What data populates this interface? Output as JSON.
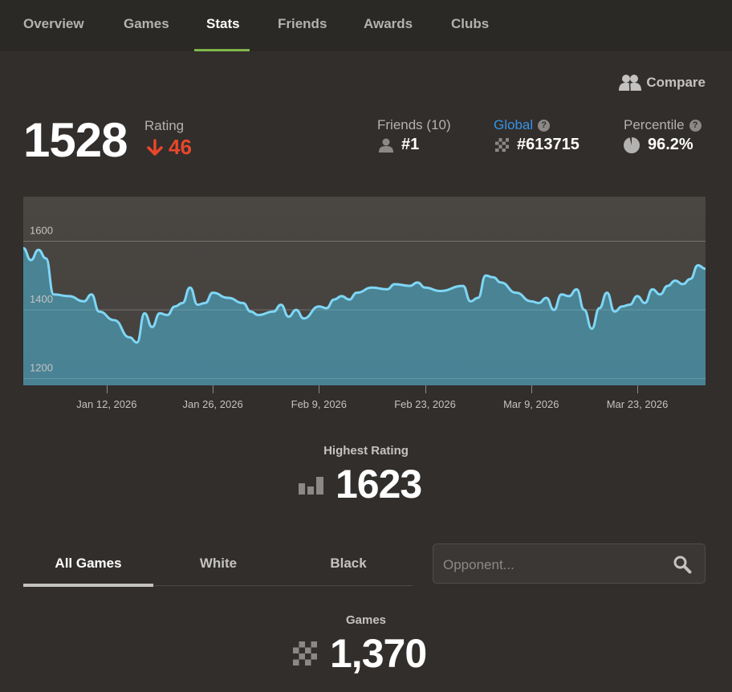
{
  "nav": {
    "tabs": [
      {
        "label": "Overview"
      },
      {
        "label": "Games"
      },
      {
        "label": "Stats",
        "active": true
      },
      {
        "label": "Friends"
      },
      {
        "label": "Awards"
      },
      {
        "label": "Clubs"
      }
    ]
  },
  "compare_label": "Compare",
  "rating": {
    "value": "1528",
    "label": "Rating",
    "change": "46",
    "change_direction": "down"
  },
  "stats": {
    "friends": {
      "label": "Friends (10)",
      "value": "#1",
      "icon": "person-icon"
    },
    "global": {
      "label": "Global",
      "value": "#613715",
      "icon": "chessboard-icon"
    },
    "percentile": {
      "label": "Percentile",
      "value": "96.2%",
      "icon": "pie-icon"
    }
  },
  "chart_data": {
    "type": "area",
    "ylim": [
      1180,
      1730
    ],
    "yticks": [
      1200,
      1400,
      1600
    ],
    "xticks": [
      {
        "label": "Jan 12, 2026",
        "day": 11
      },
      {
        "label": "Jan 26, 2026",
        "day": 25
      },
      {
        "label": "Feb 9, 2026",
        "day": 39
      },
      {
        "label": "Feb 23, 2026",
        "day": 53
      },
      {
        "label": "Mar 9, 2026",
        "day": 67
      },
      {
        "label": "Mar 23, 2026",
        "day": 81
      }
    ],
    "xrange": [
      0,
      90
    ],
    "series": [
      {
        "points": [
          [
            0,
            1580
          ],
          [
            1,
            1545
          ],
          [
            2,
            1575
          ],
          [
            3,
            1550
          ],
          [
            4,
            1445
          ],
          [
            6,
            1440
          ],
          [
            8,
            1425
          ],
          [
            9,
            1445
          ],
          [
            10,
            1395
          ],
          [
            12,
            1370
          ],
          [
            14,
            1320
          ],
          [
            15,
            1305
          ],
          [
            16,
            1390
          ],
          [
            17,
            1350
          ],
          [
            18,
            1390
          ],
          [
            19,
            1385
          ],
          [
            20,
            1410
          ],
          [
            21,
            1420
          ],
          [
            22,
            1465
          ],
          [
            23,
            1415
          ],
          [
            24,
            1420
          ],
          [
            25,
            1450
          ],
          [
            27,
            1435
          ],
          [
            29,
            1420
          ],
          [
            30,
            1395
          ],
          [
            31,
            1385
          ],
          [
            33,
            1395
          ],
          [
            34,
            1415
          ],
          [
            35,
            1380
          ],
          [
            36,
            1400
          ],
          [
            37,
            1375
          ],
          [
            39,
            1410
          ],
          [
            40,
            1405
          ],
          [
            41,
            1430
          ],
          [
            42,
            1440
          ],
          [
            43,
            1430
          ],
          [
            44,
            1450
          ],
          [
            46,
            1465
          ],
          [
            48,
            1460
          ],
          [
            49,
            1475
          ],
          [
            51,
            1470
          ],
          [
            52,
            1480
          ],
          [
            53,
            1465
          ],
          [
            55,
            1455
          ],
          [
            58,
            1470
          ],
          [
            59,
            1425
          ],
          [
            60,
            1435
          ],
          [
            61,
            1500
          ],
          [
            62,
            1495
          ],
          [
            63,
            1480
          ],
          [
            65,
            1450
          ],
          [
            67,
            1425
          ],
          [
            68,
            1420
          ],
          [
            69,
            1435
          ],
          [
            70,
            1400
          ],
          [
            71,
            1445
          ],
          [
            72,
            1440
          ],
          [
            73,
            1460
          ],
          [
            74,
            1400
          ],
          [
            75,
            1345
          ],
          [
            76,
            1405
          ],
          [
            77,
            1450
          ],
          [
            78,
            1395
          ],
          [
            79,
            1410
          ],
          [
            80,
            1415
          ],
          [
            81,
            1440
          ],
          [
            82,
            1420
          ],
          [
            83,
            1460
          ],
          [
            84,
            1445
          ],
          [
            85,
            1470
          ],
          [
            86,
            1485
          ],
          [
            87,
            1475
          ],
          [
            88,
            1490
          ],
          [
            89,
            1530
          ],
          [
            90,
            1520
          ]
        ]
      }
    ]
  },
  "highest": {
    "label": "Highest Rating",
    "value": "1623",
    "icon": "bar-chart-icon"
  },
  "filters": {
    "tabs": [
      {
        "label": "All Games",
        "active": true
      },
      {
        "label": "White"
      },
      {
        "label": "Black"
      }
    ],
    "opponent_placeholder": "Opponent..."
  },
  "games": {
    "label": "Games",
    "value": "1,370",
    "icon": "chessboard-icon"
  },
  "colors": {
    "accent_green": "#81b64c",
    "link_blue": "#3692e7",
    "loss_red": "#e8472b",
    "chart_line": "#7fd6f5",
    "chart_fill": "#4a8ea3"
  }
}
